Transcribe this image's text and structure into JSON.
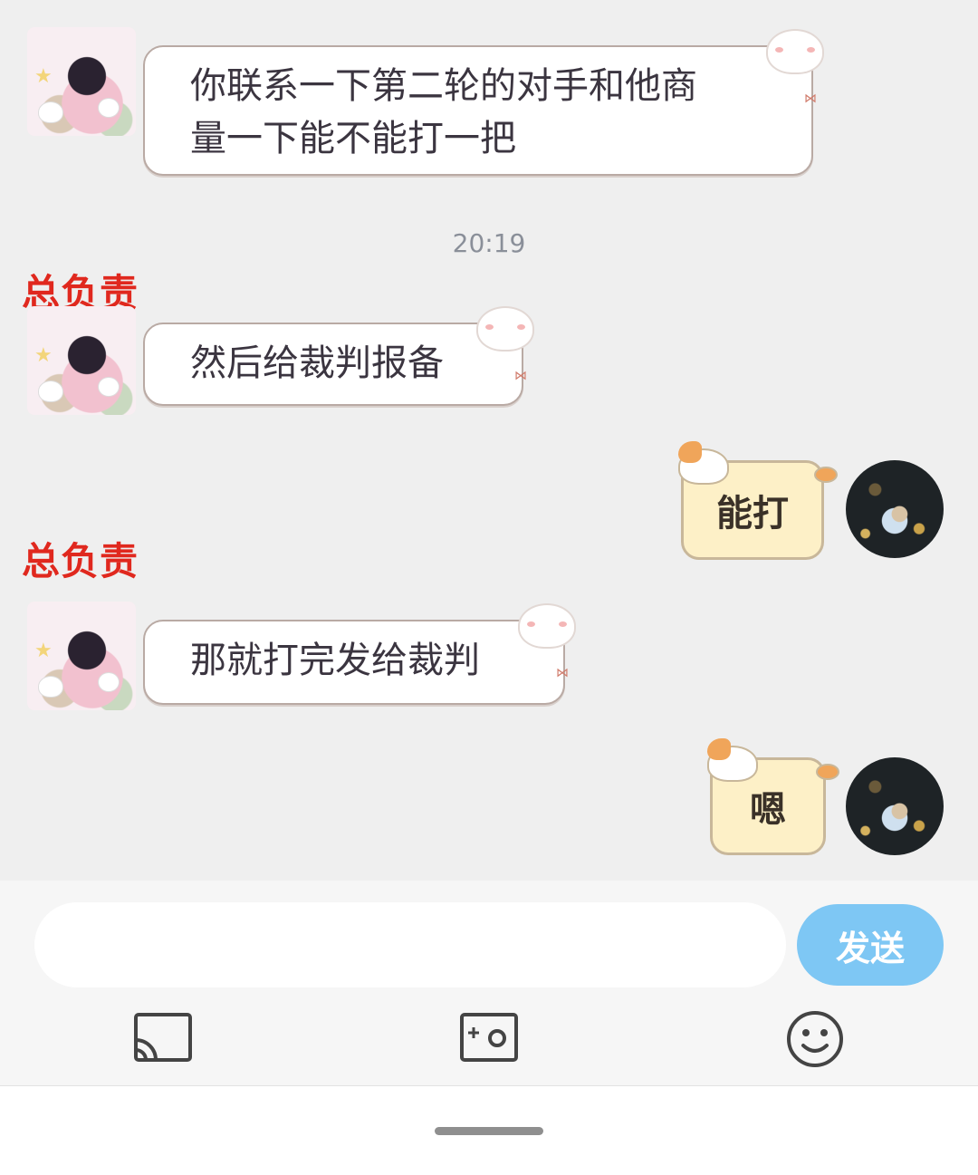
{
  "chat": {
    "timestamp": "20:19",
    "messages": [
      {
        "from": "other",
        "text_line1": "你联系一下第二轮的对手和他商",
        "text_line2": "量一下能不能打一把"
      },
      {
        "from": "other",
        "sender": "总负责",
        "text": "然后给裁判报备"
      },
      {
        "from": "me",
        "text": "能打"
      },
      {
        "from": "other",
        "sender": "总负责",
        "text": "那就打完发给裁判"
      },
      {
        "from": "me",
        "text": "嗯"
      }
    ]
  },
  "composer": {
    "input_value": "",
    "send_label": "发送"
  },
  "toolbar": {
    "icons": [
      "screen-cast-icon",
      "camera-photo-icon",
      "emoji-smile-icon"
    ]
  }
}
